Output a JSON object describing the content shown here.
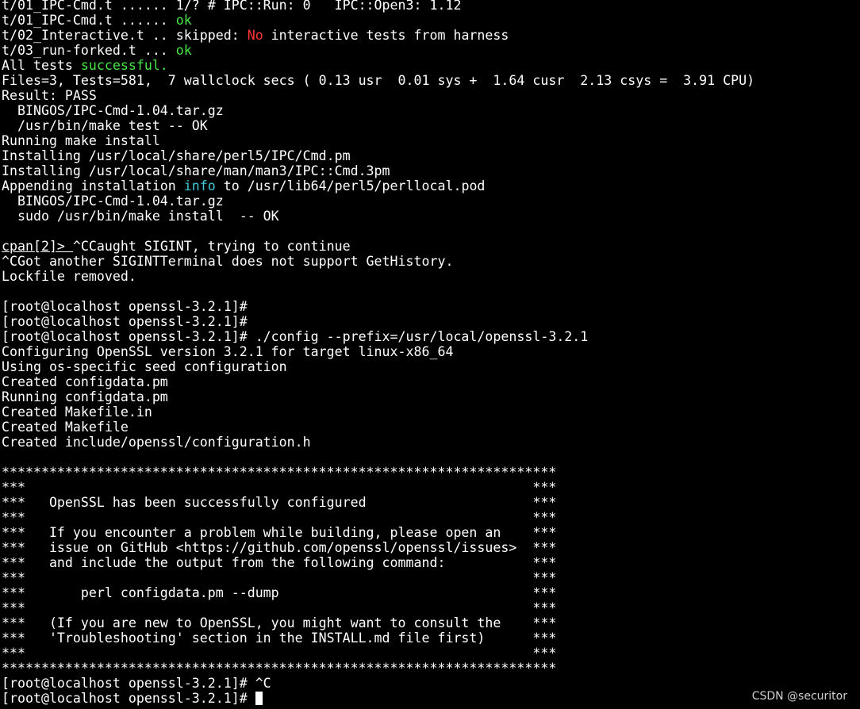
{
  "terminal": {
    "background": "#000000",
    "foreground": "#ffffff",
    "colors": {
      "red": "#ff3434",
      "green": "#47e547",
      "cyan": "#3fc9d6"
    },
    "lines": [
      {
        "segments": [
          {
            "text": "t/01_IPC-Cmd.t ...... 1/? # IPC::Run: 0   IPC::Open3: 1.12"
          }
        ]
      },
      {
        "segments": [
          {
            "text": "t/01_IPC-Cmd.t ...... "
          },
          {
            "text": "ok",
            "style": "green"
          }
        ]
      },
      {
        "segments": [
          {
            "text": "t/02_Interactive.t .. skipped: "
          },
          {
            "text": "No",
            "style": "red"
          },
          {
            "text": " interactive tests from harness"
          }
        ]
      },
      {
        "segments": [
          {
            "text": "t/03_run-forked.t ... "
          },
          {
            "text": "ok",
            "style": "green"
          }
        ]
      },
      {
        "segments": [
          {
            "text": "All tests "
          },
          {
            "text": "successful.",
            "style": "green"
          }
        ]
      },
      {
        "segments": [
          {
            "text": "Files=3, Tests=581,  7 wallclock secs ( 0.13 usr  0.01 sys +  1.64 cusr  2.13 csys =  3.91 CPU)"
          }
        ]
      },
      {
        "segments": [
          {
            "text": "Result: PASS"
          }
        ]
      },
      {
        "segments": [
          {
            "text": "  BINGOS/IPC-Cmd-1.04.tar.gz"
          }
        ]
      },
      {
        "segments": [
          {
            "text": "  /usr/bin/make test -- OK"
          }
        ]
      },
      {
        "segments": [
          {
            "text": "Running make install"
          }
        ]
      },
      {
        "segments": [
          {
            "text": "Installing /usr/local/share/perl5/IPC/Cmd.pm"
          }
        ]
      },
      {
        "segments": [
          {
            "text": "Installing /usr/local/share/man/man3/IPC::Cmd.3pm"
          }
        ]
      },
      {
        "segments": [
          {
            "text": "Appending installation "
          },
          {
            "text": "info",
            "style": "cyan"
          },
          {
            "text": " to /usr/lib64/perl5/perllocal.pod"
          }
        ]
      },
      {
        "segments": [
          {
            "text": "  BINGOS/IPC-Cmd-1.04.tar.gz"
          }
        ]
      },
      {
        "segments": [
          {
            "text": "  sudo /usr/bin/make install  -- OK"
          }
        ]
      },
      {
        "segments": [
          {
            "text": ""
          }
        ]
      },
      {
        "segments": [
          {
            "text": "cpan[2]> ",
            "style": "underline"
          },
          {
            "text": "^CCaught SIGINT, trying to continue"
          }
        ]
      },
      {
        "segments": [
          {
            "text": "^CGot another SIGINTTerminal does not support GetHistory."
          }
        ]
      },
      {
        "segments": [
          {
            "text": "Lockfile removed."
          }
        ]
      },
      {
        "segments": [
          {
            "text": ""
          }
        ]
      },
      {
        "segments": [
          {
            "text": "[root@localhost openssl-3.2.1]#"
          }
        ]
      },
      {
        "segments": [
          {
            "text": "[root@localhost openssl-3.2.1]#"
          }
        ]
      },
      {
        "segments": [
          {
            "text": "[root@localhost openssl-3.2.1]# ./config --prefix=/usr/local/openssl-3.2.1"
          }
        ]
      },
      {
        "segments": [
          {
            "text": "Configuring OpenSSL version 3.2.1 for target linux-x86_64"
          }
        ]
      },
      {
        "segments": [
          {
            "text": "Using os-specific seed configuration"
          }
        ]
      },
      {
        "segments": [
          {
            "text": "Created configdata.pm"
          }
        ]
      },
      {
        "segments": [
          {
            "text": "Running configdata.pm"
          }
        ]
      },
      {
        "segments": [
          {
            "text": "Created Makefile.in"
          }
        ]
      },
      {
        "segments": [
          {
            "text": "Created Makefile"
          }
        ]
      },
      {
        "segments": [
          {
            "text": "Created include/openssl/configuration.h"
          }
        ]
      },
      {
        "segments": [
          {
            "text": ""
          }
        ]
      },
      {
        "segments": [
          {
            "text": "**********************************************************************"
          }
        ]
      },
      {
        "segments": [
          {
            "text": "***                                                                ***"
          }
        ]
      },
      {
        "segments": [
          {
            "text": "***   OpenSSL has been successfully configured                     ***"
          }
        ]
      },
      {
        "segments": [
          {
            "text": "***                                                                ***"
          }
        ]
      },
      {
        "segments": [
          {
            "text": "***   If you encounter a problem while building, please open an    ***"
          }
        ]
      },
      {
        "segments": [
          {
            "text": "***   issue on GitHub <https://github.com/openssl/openssl/issues>  ***"
          }
        ]
      },
      {
        "segments": [
          {
            "text": "***   and include the output from the following command:           ***"
          }
        ]
      },
      {
        "segments": [
          {
            "text": "***                                                                ***"
          }
        ]
      },
      {
        "segments": [
          {
            "text": "***       perl configdata.pm --dump                                ***"
          }
        ]
      },
      {
        "segments": [
          {
            "text": "***                                                                ***"
          }
        ]
      },
      {
        "segments": [
          {
            "text": "***   (If you are new to OpenSSL, you might want to consult the    ***"
          }
        ]
      },
      {
        "segments": [
          {
            "text": "***   'Troubleshooting' section in the INSTALL.md file first)      ***"
          }
        ]
      },
      {
        "segments": [
          {
            "text": "***                                                                ***"
          }
        ]
      },
      {
        "segments": [
          {
            "text": "**********************************************************************"
          }
        ]
      },
      {
        "segments": [
          {
            "text": "[root@localhost openssl-3.2.1]# ^C"
          }
        ]
      },
      {
        "segments": [
          {
            "text": "[root@localhost openssl-3.2.1]# "
          }
        ],
        "cursor": true
      }
    ]
  },
  "watermark": {
    "text": "CSDN @securitor"
  }
}
